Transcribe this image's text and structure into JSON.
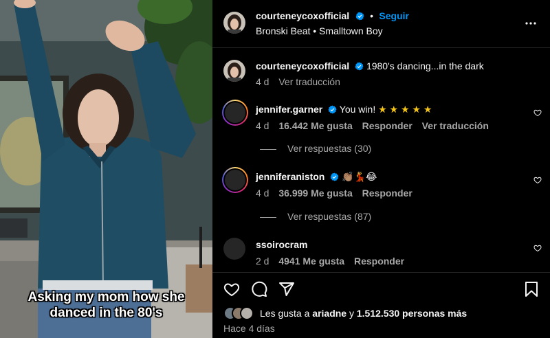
{
  "post": {
    "author": "courteneycoxofficial",
    "follow_label": "Seguir",
    "separator": "•",
    "audio": "Bronski Beat • Smalltown Boy",
    "caption_text": "1980's dancing...in the dark",
    "caption_age": "4 d",
    "translate_label": "Ver traducción",
    "video_caption_line1": "Asking my mom how she",
    "video_caption_line2": "danced in the 80's"
  },
  "comments": [
    {
      "user": "jennifer.garner",
      "verified": true,
      "text": "You win! ★ ★ ★ ★ ★",
      "age": "4 d",
      "likes": "16.442 Me gusta",
      "reply_label": "Responder",
      "translate_label": "Ver traducción",
      "view_replies": "Ver respuestas (30)"
    },
    {
      "user": "jenniferaniston",
      "verified": true,
      "text": "👏🏽💃😂",
      "age": "4 d",
      "likes": "36.999 Me gusta",
      "reply_label": "Responder",
      "view_replies": "Ver respuestas (87)"
    },
    {
      "user": "ssoirocram",
      "verified": false,
      "text": "",
      "age": "2 d",
      "likes": "4941 Me gusta",
      "reply_label": "Responder"
    }
  ],
  "footer": {
    "likes_prefix": "Les gusta a",
    "likes_user": "ariadne",
    "likes_middle": "y",
    "likes_count": "1.512.530 personas más",
    "time": "Hace 4 días"
  },
  "icons": {
    "more": "more-options-icon",
    "like": "heart-icon",
    "comment": "comment-icon",
    "share": "send-icon",
    "save": "bookmark-icon",
    "verified": "verified-badge-icon"
  },
  "colors": {
    "accent": "#0095f6",
    "secondary_text": "#a8a8a8",
    "star": "#f5c518"
  }
}
